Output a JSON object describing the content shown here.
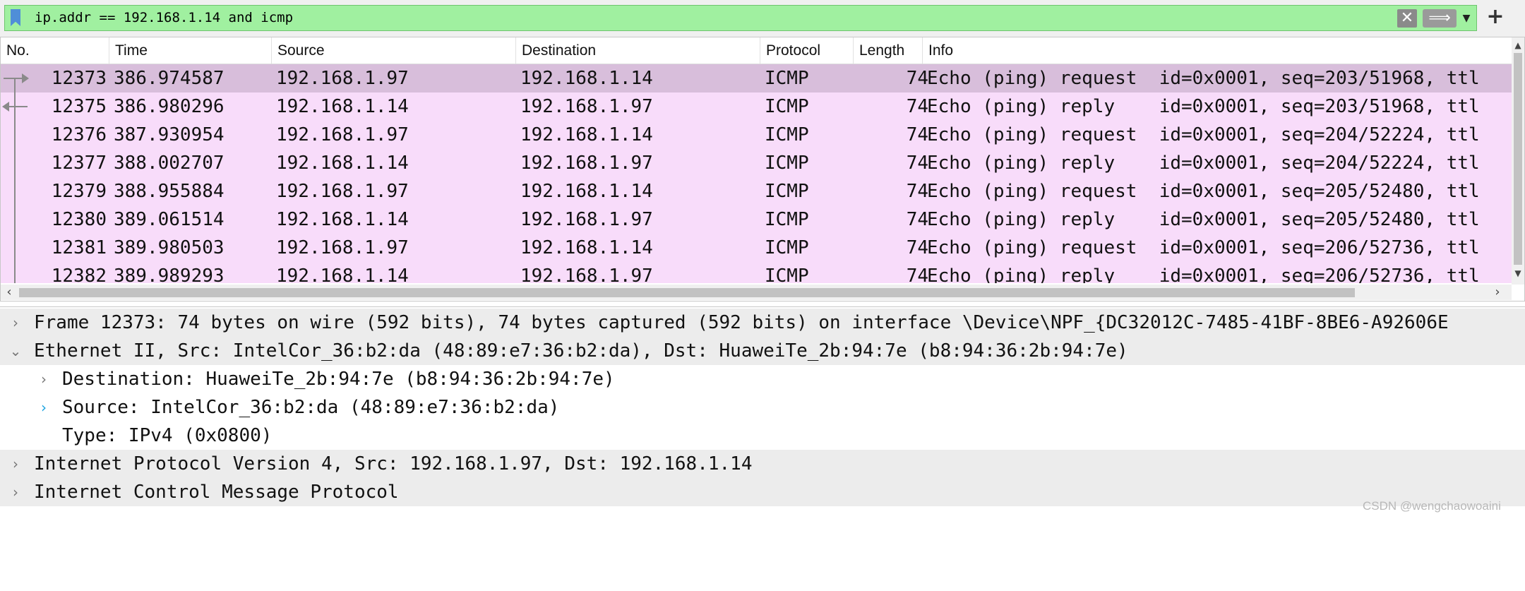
{
  "filter": {
    "expression": "ip.addr == 192.168.1.14 and icmp",
    "clear_icon": "✕",
    "apply_icon": "⟹",
    "dropdown_icon": "▼",
    "add_icon": "+"
  },
  "packet_list": {
    "columns": [
      "No.",
      "Time",
      "Source",
      "Destination",
      "Protocol",
      "Length",
      "Info"
    ],
    "rows": [
      {
        "no": "12373",
        "time": "386.974587",
        "src": "192.168.1.97",
        "dst": "192.168.1.14",
        "proto": "ICMP",
        "len": "74",
        "info": "Echo (ping) request  id=0x0001, seq=203/51968, ttl"
      },
      {
        "no": "12375",
        "time": "386.980296",
        "src": "192.168.1.14",
        "dst": "192.168.1.97",
        "proto": "ICMP",
        "len": "74",
        "info": "Echo (ping) reply    id=0x0001, seq=203/51968, ttl"
      },
      {
        "no": "12376",
        "time": "387.930954",
        "src": "192.168.1.97",
        "dst": "192.168.1.14",
        "proto": "ICMP",
        "len": "74",
        "info": "Echo (ping) request  id=0x0001, seq=204/52224, ttl"
      },
      {
        "no": "12377",
        "time": "388.002707",
        "src": "192.168.1.14",
        "dst": "192.168.1.97",
        "proto": "ICMP",
        "len": "74",
        "info": "Echo (ping) reply    id=0x0001, seq=204/52224, ttl"
      },
      {
        "no": "12379",
        "time": "388.955884",
        "src": "192.168.1.97",
        "dst": "192.168.1.14",
        "proto": "ICMP",
        "len": "74",
        "info": "Echo (ping) request  id=0x0001, seq=205/52480, ttl"
      },
      {
        "no": "12380",
        "time": "389.061514",
        "src": "192.168.1.14",
        "dst": "192.168.1.97",
        "proto": "ICMP",
        "len": "74",
        "info": "Echo (ping) reply    id=0x0001, seq=205/52480, ttl"
      },
      {
        "no": "12381",
        "time": "389.980503",
        "src": "192.168.1.97",
        "dst": "192.168.1.14",
        "proto": "ICMP",
        "len": "74",
        "info": "Echo (ping) request  id=0x0001, seq=206/52736, ttl"
      },
      {
        "no": "12382",
        "time": "389.989293",
        "src": "192.168.1.14",
        "dst": "192.168.1.97",
        "proto": "ICMP",
        "len": "74",
        "info": "Echo (ping) reply    id=0x0001, seq=206/52736, ttl"
      }
    ],
    "selected_index": 0,
    "colors": {
      "row": "#f8dcfa",
      "selected": "#d8bedb"
    }
  },
  "details": {
    "frame": "Frame 12373: 74 bytes on wire (592 bits), 74 bytes captured (592 bits) on interface \\Device\\NPF_{DC32012C-7485-41BF-8BE6-A92606E",
    "ethernet": "Ethernet II, Src: IntelCor_36:b2:da (48:89:e7:36:b2:da), Dst: HuaweiTe_2b:94:7e (b8:94:36:2b:94:7e)",
    "destination": "Destination: HuaweiTe_2b:94:7e (b8:94:36:2b:94:7e)",
    "source": "Source: IntelCor_36:b2:da (48:89:e7:36:b2:da)",
    "type": "Type: IPv4 (0x0800)",
    "ipv4": "Internet Protocol Version 4, Src: 192.168.1.97, Dst: 192.168.1.14",
    "icmp": "Internet Control Message Protocol",
    "collapsed_icon": "›",
    "expanded_icon": "⌄"
  },
  "watermark": "CSDN @wengchaowoaini"
}
